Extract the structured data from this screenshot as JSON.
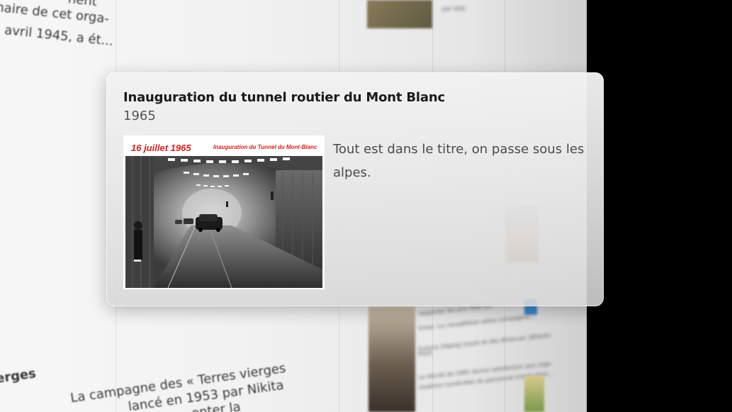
{
  "background": {
    "text_fragments": {
      "top_left_1": "naire de cet orga-",
      "top_left_2": "avril 1945, a ét...",
      "top_left_0": "nent",
      "bottom_left_1": "erges",
      "bottom_left_2": "La campagne des « Terres vierges",
      "bottom_left_3": "lancé en 1953 par Nikita",
      "bottom_left_4": "enter la",
      "right_col_1": "respecter les prix fixes pa...",
      "right_col_2": "times. La compétition entre compagnie...",
      "right_col_3": "fusions (Hapag Lloyd) et des Alliances (Atlantic",
      "right_col_4": "Pool)",
      "right_col_5": "Le décret de 1982 donne satisfaction aux orga-",
      "right_col_6": "nisations syndicales du personnel d'exécution...",
      "right_col_top": "par VGE."
    }
  },
  "card": {
    "title": "Inauguration du tunnel routier du Mont Blanc",
    "year": "1965",
    "image": {
      "caption_date": "16 juillet 1965",
      "caption_title": "Inauguration du Tunnel du Mont-Blanc",
      "alt": "tunnel-photo"
    },
    "description": "Tout est dans le titre, on passe sous les alpes."
  }
}
